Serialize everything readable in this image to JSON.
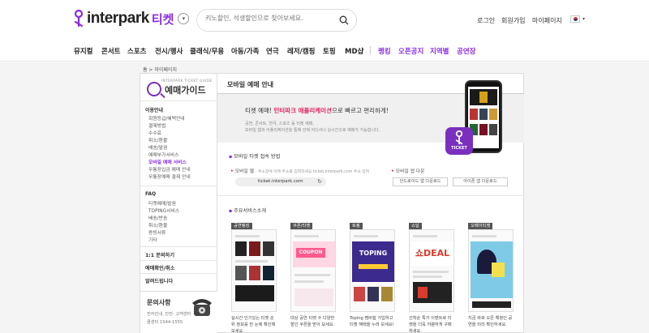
{
  "header": {
    "brand": "interpark",
    "brand_sub": "티켓",
    "search_placeholder": "키노할인, 석생할인으로 찾아보세요.",
    "links": [
      "로그인",
      "회원가입",
      "마이페이지"
    ]
  },
  "nav": {
    "items": [
      "뮤지컬",
      "콘서트",
      "스포츠",
      "전시/행사",
      "클래식/무용",
      "아동/가족",
      "연극",
      "레저/캠핑",
      "토핑",
      "MD샵"
    ],
    "highlight_items": [
      "랭킹",
      "오픈공지",
      "지역별",
      "공연장"
    ]
  },
  "breadcrumb": "홈 > 마이페이지",
  "sidebar": {
    "guide_small": "INTERPARK TICKET GUIDE",
    "guide_title": "예매가이드",
    "sec1_title": "이용안내",
    "sec1_items": [
      "회원등급/혜택안내",
      "결제방법",
      "수수료",
      "취소/환불",
      "배송/발권",
      "예매부가서비스",
      "모바일 예매 서비스",
      "무통장입금 예매 안내",
      "무통장예매 결제 안내"
    ],
    "sec2_title": "FAQ",
    "sec2_items": [
      "티켓예매/발권",
      "TOPING서비스",
      "배송/반송",
      "취소/환불",
      "증빙서류",
      "기타"
    ],
    "links": [
      "1:1 문의하기",
      "예매확인/취소",
      "알려드립니다"
    ],
    "cs_title": "문의사항",
    "cs_lines": [
      "전자안내, 안전: 고객센터",
      "콜센터 1544-1555"
    ]
  },
  "main": {
    "title": "모바일 예매 안내",
    "banner_head_pre": "티켓 예매! ",
    "banner_head_hl": "인터파크 애플리케이션",
    "banner_head_post": "으로 빠르고 편리하게!",
    "banner_sub": [
      "공연, 콘서트, 연극, 스포츠 등 티켓 예매,",
      "모바일 웹과 어플리케이션을 통해 언제 어디서나 실시간으로 예매가 가능합니다."
    ],
    "ticket_badge": "TICKET",
    "section1": "모바일 티켓 접속 방법",
    "web_label": "모바일 웹",
    "web_desc": "- 주소창에 아래 주소를 입력하세요 ticket.interpark.com 주소 입력",
    "url": "ticket.interpark.com",
    "app_label": "모바일 앱 다운",
    "app_buttons": [
      "안드로이드 앱 다운로드",
      "아이폰 앱 다운로드"
    ],
    "section2": "주요서비스소개",
    "cards": [
      {
        "tag": "공연랭킹",
        "desc": "실시간 인기있는 티켓 순위 정보를 한 눈에 확인해 보세요.",
        "accent": "#222222"
      },
      {
        "tag": "쿠폰/티켓",
        "desc": "대상 공연 티켓 수 다양한 할인 쿠폰을 받아 보세요.",
        "accent": "#ff5a8c"
      },
      {
        "tag": "토핑",
        "desc": "Toping 멤버쉽 가입하고 티켓 혜택을 누려 보세요!",
        "accent": "#3d2a8f"
      },
      {
        "tag": "쇼딜",
        "desc": "선착순 특가 이벤트로 티켓을 더욱 저렴하게 구매하세요.",
        "accent": "#d93a2b"
      },
      {
        "tag": "오메이티켓",
        "desc": "지금 바로 오픈 예정인 공연을 미리 확인하세요.",
        "accent": "#7ecbe8"
      }
    ]
  },
  "colors": {
    "brand_purple": "#8a2be2",
    "highlight_pink": "#e0245e"
  }
}
